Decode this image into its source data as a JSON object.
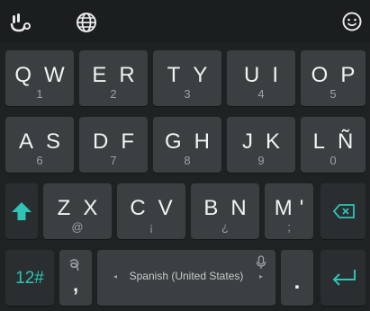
{
  "topbar": {
    "logo_icon": "keyboard-logo-icon",
    "globe_icon": "globe-icon",
    "emoji_icon": "emoji-icon"
  },
  "rows": {
    "row1": [
      {
        "letters": [
          "Q",
          "W"
        ],
        "sub": "1"
      },
      {
        "letters": [
          "E",
          "R"
        ],
        "sub": "2"
      },
      {
        "letters": [
          "T",
          "Y"
        ],
        "sub": "3"
      },
      {
        "letters": [
          "U",
          "I"
        ],
        "sub": "4"
      },
      {
        "letters": [
          "O",
          "P"
        ],
        "sub": "5"
      }
    ],
    "row2": [
      {
        "letters": [
          "A",
          "S"
        ],
        "sub": "6"
      },
      {
        "letters": [
          "D",
          "F"
        ],
        "sub": "7"
      },
      {
        "letters": [
          "G",
          "H"
        ],
        "sub": "8"
      },
      {
        "letters": [
          "J",
          "K"
        ],
        "sub": "9"
      },
      {
        "letters": [
          "L",
          "Ñ"
        ],
        "sub": "0"
      }
    ],
    "row3": [
      {
        "letters": [
          "Z",
          "X"
        ],
        "sub": "@"
      },
      {
        "letters": [
          "C",
          "V"
        ],
        "sub": "¡"
      },
      {
        "letters": [
          "B",
          "N"
        ],
        "sub": "¿"
      },
      {
        "letters": [
          "M",
          "'"
        ],
        "sub": ";"
      }
    ]
  },
  "bottom": {
    "numbers_label": "12#",
    "comma_label": ",",
    "space_label": "Spanish (United States)",
    "period_label": "."
  },
  "colors": {
    "accent": "#2ec4b6",
    "key": "#3a3f41",
    "background": "#1f2223"
  }
}
